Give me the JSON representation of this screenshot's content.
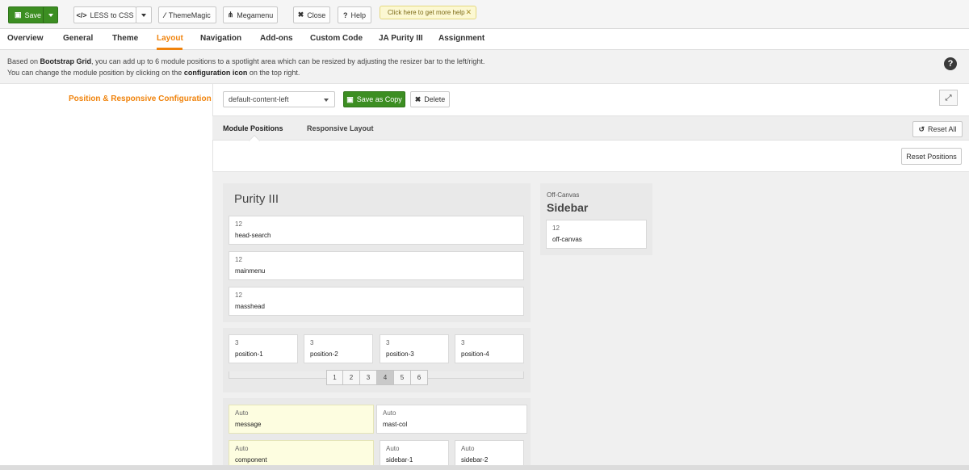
{
  "toolbar": {
    "save_label": "Save",
    "less_label": "LESS to CSS",
    "thememagic_label": "ThemeMagic",
    "megamenu_label": "Megamenu",
    "close_label": "Close",
    "help_label": "Help",
    "hint_text": "Click here to get more help",
    "hint_close": "✕"
  },
  "tabs": [
    "Overview",
    "General",
    "Theme",
    "Layout",
    "Navigation",
    "Add-ons",
    "Custom Code",
    "JA Purity III",
    "Assignment"
  ],
  "active_tab": "Layout",
  "info": {
    "line1_a": "Based on ",
    "line1_b": "Bootstrap Grid",
    "line1_c": ", you can add up to 6 module positions to a spotlight area which can be resized by adjusting the resizer bar to the left/right.",
    "line2_a": "You can change the module position by clicking on the ",
    "line2_b": "configuration icon",
    "line2_c": " on the top right."
  },
  "config": {
    "section_label": "Position & Responsive Configuration",
    "layout_select": "default-content-left",
    "save_copy_label": "Save as Copy",
    "delete_label": "Delete",
    "subtab_positions": "Module Positions",
    "subtab_responsive": "Responsive Layout",
    "reset_all_label": "Reset All",
    "reset_positions_label": "Reset Positions"
  },
  "main_panel": {
    "title": "Purity III",
    "header_positions": [
      {
        "width": "12",
        "name": "head-search"
      },
      {
        "width": "12",
        "name": "mainmenu"
      },
      {
        "width": "12",
        "name": "masshead"
      }
    ],
    "spotlight": [
      {
        "width": "3",
        "name": "position-1"
      },
      {
        "width": "3",
        "name": "position-2"
      },
      {
        "width": "3",
        "name": "position-3"
      },
      {
        "width": "3",
        "name": "position-4"
      }
    ],
    "pager": [
      "1",
      "2",
      "3",
      "4",
      "5",
      "6"
    ],
    "pager_selected": "4",
    "mast": [
      {
        "width": "Auto",
        "name": "message"
      },
      {
        "width": "Auto",
        "name": "mast-col"
      }
    ],
    "content": [
      {
        "width": "Auto",
        "name": "component"
      },
      {
        "width": "Auto",
        "name": "sidebar-1"
      },
      {
        "width": "Auto",
        "name": "sidebar-2"
      }
    ]
  },
  "offcanvas": {
    "label": "Off-Canvas",
    "title": "Sidebar",
    "position": {
      "width": "12",
      "name": "off-canvas"
    }
  },
  "colors": {
    "accent": "#f0830c",
    "save_green": "#3c8e22",
    "highlight_yellow": "#fdfde0"
  }
}
